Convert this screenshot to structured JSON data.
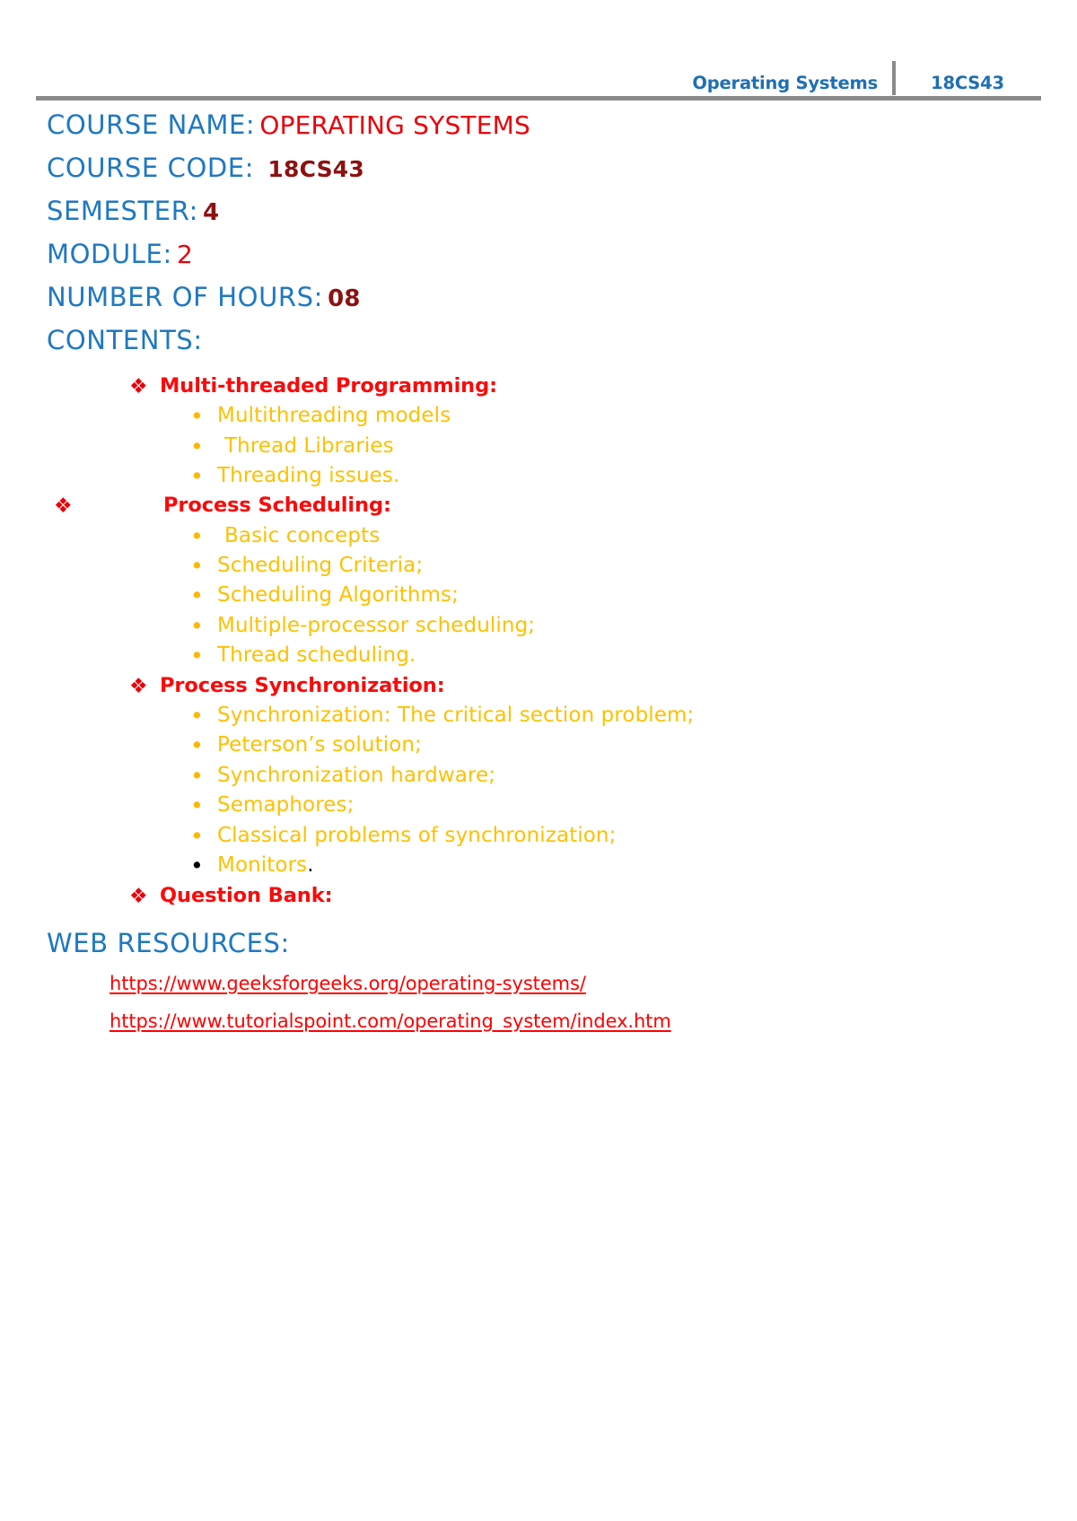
{
  "header": {
    "title": "Operating Systems",
    "course_code": "18CS43",
    "accent_color": "#1F6FB4",
    "rule_color": "#8a8a8a"
  },
  "meta": {
    "course_name_label": "COURSE NAME:",
    "course_name_value": "OPERATING SYSTEMS",
    "course_code_label": "COURSE CODE:",
    "course_code_value": "18CS43",
    "semester_label": "SEMESTER:",
    "semester_value": "4",
    "module_label": "MODULE:",
    "module_value": "2",
    "hours_label": "NUMBER OF HOURS:",
    "hours_value": "08",
    "contents_label": "CONTENTS:"
  },
  "colors": {
    "label_blue": "#1F78C1",
    "value_bright_red": "#E8000B",
    "value_dark_red": "#8C1111",
    "section_red": "#FA0A0A",
    "bullet_amber": "#FFC000",
    "link_red": "#FF0000"
  },
  "icons": {
    "diamond_bullet": "❖",
    "round_bullet": "•"
  },
  "contents": {
    "sections": [
      {
        "title": "Multi-threaded Programming:",
        "items": [
          "Multithreading models",
          "Thread Libraries",
          "Threading issues."
        ]
      },
      {
        "title": "Process Scheduling:",
        "items": [
          "Basic concepts",
          "Scheduling Criteria;",
          "Scheduling Algorithms;",
          "Multiple-processor scheduling;",
          "Thread scheduling."
        ]
      },
      {
        "title": "Process Synchronization:",
        "items": [
          "Synchronization: The critical section problem;",
          "Peterson’s solution;",
          "Synchronization hardware;",
          "Semaphores;",
          "Classical problems of synchronization;",
          "Monitors"
        ]
      },
      {
        "title": "Question Bank:",
        "items": []
      }
    ]
  },
  "web_resources": {
    "heading": "WEB RESOURCES:",
    "links": [
      "https://www.geeksforgeeks.org/operating-systems/",
      "https://www.tutorialspoint.com/operating_system/index.htm"
    ]
  }
}
